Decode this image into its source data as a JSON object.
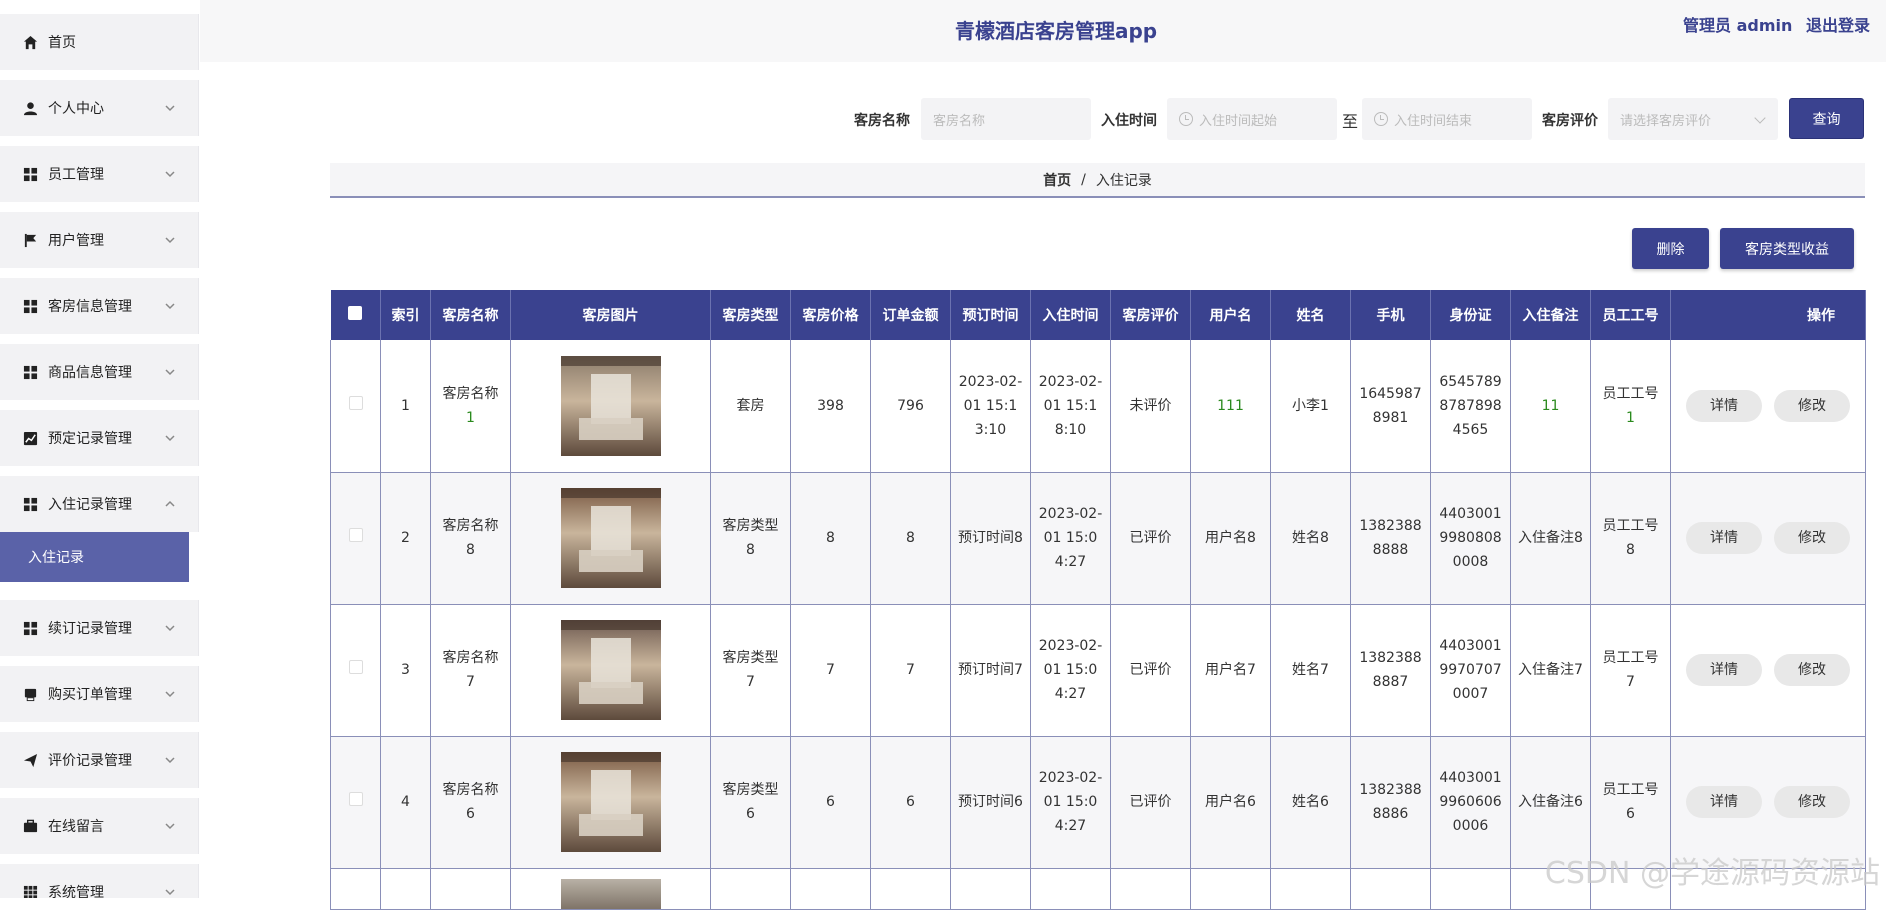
{
  "header": {
    "title": "青檬酒店客房管理app",
    "user": "管理员 admin",
    "logout": "退出登录"
  },
  "sidebar": {
    "items": [
      {
        "label": "首页",
        "icon": "home-icon",
        "chevron": false
      },
      {
        "label": "个人中心",
        "icon": "user-icon",
        "chevron": true
      },
      {
        "label": "员工管理",
        "icon": "grid-icon",
        "chevron": true
      },
      {
        "label": "用户管理",
        "icon": "flag-icon",
        "chevron": true
      },
      {
        "label": "客房信息管理",
        "icon": "grid-icon",
        "chevron": true
      },
      {
        "label": "商品信息管理",
        "icon": "grid-icon",
        "chevron": true
      },
      {
        "label": "预定记录管理",
        "icon": "chart-icon",
        "chevron": true
      },
      {
        "label": "入住记录管理",
        "icon": "grid-icon",
        "chevron": true,
        "expanded": true
      },
      {
        "label": "续订记录管理",
        "icon": "grid-icon",
        "chevron": true
      },
      {
        "label": "购买订单管理",
        "icon": "printer-icon",
        "chevron": true
      },
      {
        "label": "评价记录管理",
        "icon": "send-icon",
        "chevron": true
      },
      {
        "label": "在线留言",
        "icon": "briefcase-icon",
        "chevron": true
      },
      {
        "label": "系统管理",
        "icon": "apps-icon",
        "chevron": true
      }
    ],
    "active_sub": "入住记录"
  },
  "search": {
    "room_name_label": "客房名称",
    "room_name_placeholder": "客房名称",
    "checkin_label": "入住时间",
    "checkin_start_placeholder": "入住时间起始",
    "range_sep": "至",
    "checkin_end_placeholder": "入住时间结束",
    "rating_label": "客房评价",
    "rating_placeholder": "请选择客房评价",
    "query_button": "查询"
  },
  "breadcrumb": {
    "home": "首页",
    "sep": "/",
    "current": "入住记录"
  },
  "actions": {
    "delete": "删除",
    "revenue": "客房类型收益"
  },
  "table": {
    "columns": [
      "索引",
      "客房名称",
      "客房图片",
      "客房类型",
      "客房价格",
      "订单金额",
      "预订时间",
      "入住时间",
      "客房评价",
      "用户名",
      "姓名",
      "手机",
      "身份证",
      "入住备注",
      "员工工号",
      "操作"
    ],
    "detail_label": "详情",
    "edit_label": "修改",
    "rows": [
      {
        "index": "1",
        "room_name": "客房名称",
        "room_name_num": "1",
        "room_type": "套房",
        "room_type_num": "",
        "price": "398",
        "amount": "796",
        "booking_time": "2023-02-01 15:13:10",
        "checkin_time": "2023-02-01 15:18:10",
        "rating": "未评价",
        "username": "111",
        "name": "小李1",
        "phone": "16459878981",
        "idcard": "654578987878984565",
        "remark": "11",
        "emp_no": "员工工号",
        "emp_no_num": "1",
        "image_tone": "#8b7b6a"
      },
      {
        "index": "2",
        "room_name": "客房名称",
        "room_name_num": "8",
        "room_type": "客房类型",
        "room_type_num": "8",
        "price": "8",
        "amount": "8",
        "booking_time": "预订时间8",
        "checkin_time": "2023-02-01 15:04:27",
        "rating": "已评价",
        "username": "用户名8",
        "name": "姓名8",
        "phone": "13823888888",
        "idcard": "440300199808080008",
        "remark": "入住备注8",
        "emp_no": "员工工号",
        "emp_no_num": "8",
        "image_tone": "#7a5a44"
      },
      {
        "index": "3",
        "room_name": "客房名称",
        "room_name_num": "7",
        "room_type": "客房类型",
        "room_type_num": "7",
        "price": "7",
        "amount": "7",
        "booking_time": "预订时间7",
        "checkin_time": "2023-02-01 15:04:27",
        "rating": "已评价",
        "username": "用户名7",
        "name": "姓名7",
        "phone": "13823888887",
        "idcard": "440300199707070007",
        "remark": "入住备注7",
        "emp_no": "员工工号",
        "emp_no_num": "7",
        "image_tone": "#6e5a50"
      },
      {
        "index": "4",
        "room_name": "客房名称",
        "room_name_num": "6",
        "room_type": "客房类型",
        "room_type_num": "6",
        "price": "6",
        "amount": "6",
        "booking_time": "预订时间6",
        "checkin_time": "2023-02-01 15:04:27",
        "rating": "已评价",
        "username": "用户名6",
        "name": "姓名6",
        "phone": "13823888886",
        "idcard": "440300199606060006",
        "remark": "入住备注6",
        "emp_no": "员工工号",
        "emp_no_num": "6",
        "image_tone": "#7a5a44"
      }
    ]
  },
  "watermark": "CSDN @学途源码资源站",
  "colors": {
    "primary": "#3a428f",
    "active_sub": "#5a62a8",
    "green_text": "#2b8a1e"
  }
}
